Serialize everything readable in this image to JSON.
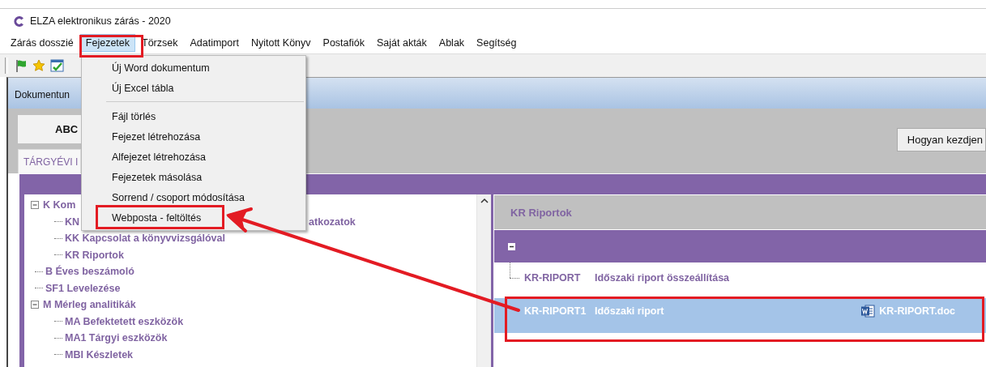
{
  "window": {
    "title": "ELZA elektronikus zárás - 2020"
  },
  "menu_bar": [
    {
      "label": "Zárás dosszié",
      "selected": false
    },
    {
      "label": "Fejezetek",
      "selected": true
    },
    {
      "label": "Törzsek",
      "selected": false
    },
    {
      "label": "Adatimport",
      "selected": false
    },
    {
      "label": "Nyitott Könyv",
      "selected": false
    },
    {
      "label": "Postafiók",
      "selected": false
    },
    {
      "label": "Saját akták",
      "selected": false
    },
    {
      "label": "Ablak",
      "selected": false
    },
    {
      "label": "Segítség",
      "selected": false
    }
  ],
  "open_menu": {
    "items": [
      {
        "kind": "item",
        "label": "Új Word dokumentum"
      },
      {
        "kind": "item",
        "label": "Új Excel tábla"
      },
      {
        "kind": "separator"
      },
      {
        "kind": "item",
        "label": "Fájl törlés"
      },
      {
        "kind": "item",
        "label": "Fejezet létrehozása"
      },
      {
        "kind": "item",
        "label": "Alfejezet létrehozása"
      },
      {
        "kind": "item",
        "label": "Fejezetek másolása"
      },
      {
        "kind": "item",
        "label": "Sorrend / csoport módosítása"
      },
      {
        "kind": "item",
        "label": "Webposta - feltöltés"
      }
    ]
  },
  "document_window": {
    "title": "Dokumentun"
  },
  "view_button": "ABC",
  "help_button": "Hogyan kezdjen",
  "tabs": [
    {
      "label": "TÁRGYÉVI I",
      "selected": true
    }
  ],
  "tree": [
    {
      "label": "K Kom",
      "expanded": true,
      "children": [
        {
          "label": "KN",
          "trailing": "atkozatok"
        },
        {
          "label": "KK Kapcsolat a könyvvizsgálóval"
        },
        {
          "label": "KR Riportok"
        }
      ]
    },
    {
      "label": "B Éves beszámoló"
    },
    {
      "label": "SF1 Levelezése"
    },
    {
      "label": "M Mérleg analitikák",
      "expanded": true,
      "children": [
        {
          "label": "MA Befektetett eszközök"
        },
        {
          "label": "MA1 Tárgyi eszközök"
        },
        {
          "label": "MBI Készletek"
        }
      ]
    }
  ],
  "report_panel": {
    "title": "KR Riportok",
    "group_expanded": true,
    "rows": [
      {
        "code": "KR-RIPORT",
        "name": "Időszaki riport összeállítása",
        "selected": false
      },
      {
        "code": "KR-RIPORT1",
        "name": "Időszaki riport",
        "file": "KR-RIPORT.doc",
        "selected": true
      }
    ]
  }
}
